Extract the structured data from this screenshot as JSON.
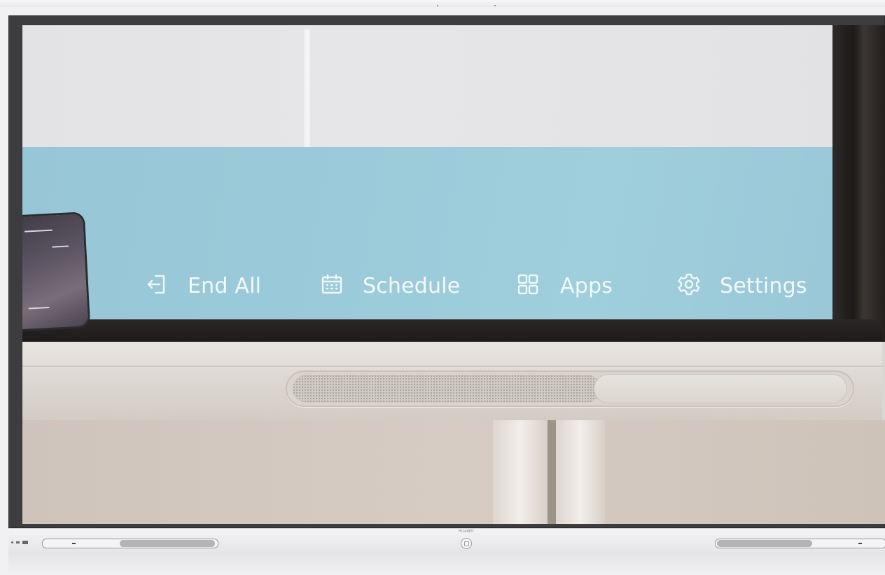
{
  "launcher": {
    "items": [
      {
        "label": "End All",
        "icon": "exit-icon"
      },
      {
        "label": "Schedule",
        "icon": "calendar-icon"
      },
      {
        "label": "Apps",
        "icon": "grid-icon"
      },
      {
        "label": "Settings",
        "icon": "gear-icon"
      }
    ]
  },
  "device": {
    "brand": "HUAWEI"
  },
  "colors": {
    "panel_blue": "#9bcbda",
    "label_white": "#ffffff",
    "bezel_dark": "#3d3d40"
  }
}
